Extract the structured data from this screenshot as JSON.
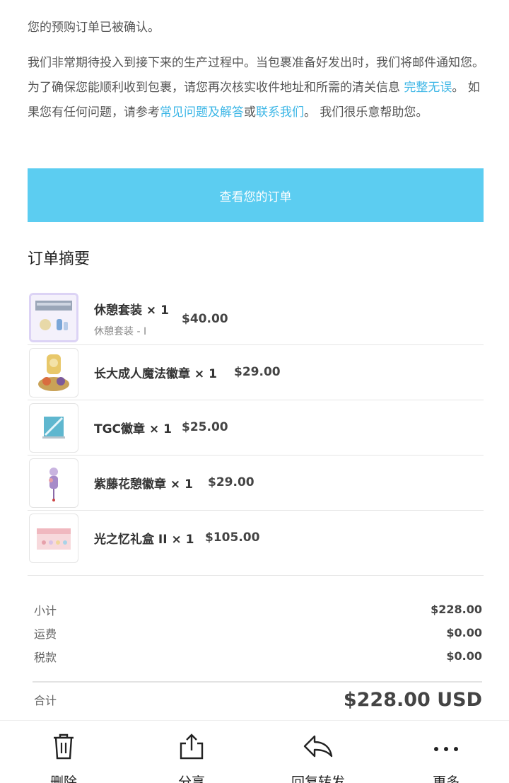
{
  "email": {
    "confirm_text": "您的预购订单已被确认。",
    "para_part1": "我们非常期待投入到接下来的生产过程中。当包裹准备好发出时，我们将邮件通知您。 为了确保您能顺利收到包裹，请您再次核实收件地址和所需的清关信息 ",
    "para_link1": "完整无误",
    "para_part2": "。 如果您有任何问题，请参考",
    "para_link2": "常见问题及解答",
    "para_part3": "或",
    "para_link3": "联系我们",
    "para_part4": "。 我们很乐意帮助您。",
    "cta_label": "查看您的订单"
  },
  "summary": {
    "title": "订单摘要",
    "items": [
      {
        "name": "休憩套装 × 1",
        "variant": "休憩套装 - I",
        "price": "$40.00"
      },
      {
        "name": "长大成人魔法徽章 × 1",
        "price": "$29.00"
      },
      {
        "name": "TGC徽章 × 1",
        "price": "$25.00"
      },
      {
        "name": "紫藤花憩徽章 × 1",
        "price": "$29.00"
      },
      {
        "name": "光之忆礼盒 II × 1",
        "price": "$105.00"
      }
    ],
    "subtotal_label": "小计",
    "subtotal": "$228.00",
    "shipping_label": "运费",
    "shipping": "$0.00",
    "tax_label": "税款",
    "tax": "$0.00",
    "total_label": "合计",
    "total": "$228.00 USD"
  },
  "toolbar": {
    "delete": "删除",
    "share": "分享",
    "reply": "回复转发",
    "more": "更多"
  },
  "colors": {
    "accent": "#5ccdf1",
    "link": "#3cb6e6"
  }
}
